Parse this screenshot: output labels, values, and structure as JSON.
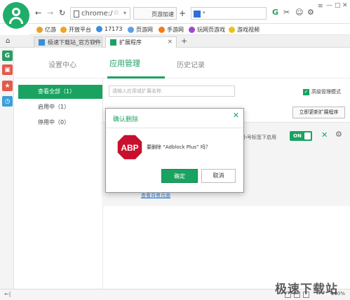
{
  "toolbar": {
    "back_icon": "←",
    "forward_icon": "→",
    "reload_icon": "↻",
    "url_text": "chrome:/",
    "star_icon": "☆",
    "dropdown_icon": "▾",
    "speed_label": "页游加速",
    "plus_icon": "+",
    "search_dropdown": "▾",
    "right_icons": [
      "G",
      "✂",
      "☺",
      "⚙",
      "≡"
    ],
    "window_controls": [
      "—",
      "□",
      "✕"
    ]
  },
  "bookmarks": [
    {
      "label": "亿游",
      "color": "#e8a12b"
    },
    {
      "label": "开放平台",
      "color": "#f0a51b"
    },
    {
      "label": "17173",
      "color": "#3b8ed8"
    },
    {
      "label": "页游网",
      "color": "#5aa0e6"
    },
    {
      "label": "手游网",
      "color": "#f07c1c"
    },
    {
      "label": "玩网页游戏",
      "color": "#a349c8"
    },
    {
      "label": "游戏视频",
      "color": "#e9c31d"
    }
  ],
  "tabs": [
    {
      "label": "极速下载站_官方软件",
      "close": "×"
    },
    {
      "label": "扩展程序",
      "close": "×"
    }
  ],
  "new_tab_icon": "+",
  "home_icon": "⌂",
  "rail": [
    {
      "name": "game-center",
      "glyph": "G",
      "color": "#2a9c64"
    },
    {
      "name": "gamepad",
      "glyph": "▣",
      "color": "#e25a4a"
    },
    {
      "name": "favorites",
      "glyph": "★",
      "color": "#e25a4a"
    },
    {
      "name": "history",
      "glyph": "◷",
      "color": "#3d9ed7"
    }
  ],
  "topnav": {
    "settings": "设置中心",
    "apps": "应用管理",
    "history": "历史记录"
  },
  "sidebar": {
    "items": [
      {
        "label": "查看全部（1）",
        "active": true
      },
      {
        "label": "启用中（1）",
        "active": false
      },
      {
        "label": "停用中（0）",
        "active": false
      }
    ]
  },
  "extensions": {
    "search_placeholder": "请输入应用或扩展名称",
    "dev_mode_label": "高级管理模式",
    "dev_mode_checked": true,
    "update_button": "立即更新扩展程序",
    "incognito_label": "小号标签下启用",
    "toggle_label": "ON",
    "remove_icon": "✕",
    "settings_icon": "⚙",
    "details_link": "查看背景页面"
  },
  "dialog": {
    "title": "确认删除",
    "close_icon": "✕",
    "logo_text": "ABP",
    "message": "要删除 “Adblock Plus” 吗？",
    "confirm": "确定",
    "cancel": "取消"
  },
  "statusbar": {
    "left": "←|",
    "zoom": "100%"
  },
  "watermark": "极速下载站",
  "colors": {
    "accent": "#1aa261",
    "abp_red": "#c8102e"
  }
}
